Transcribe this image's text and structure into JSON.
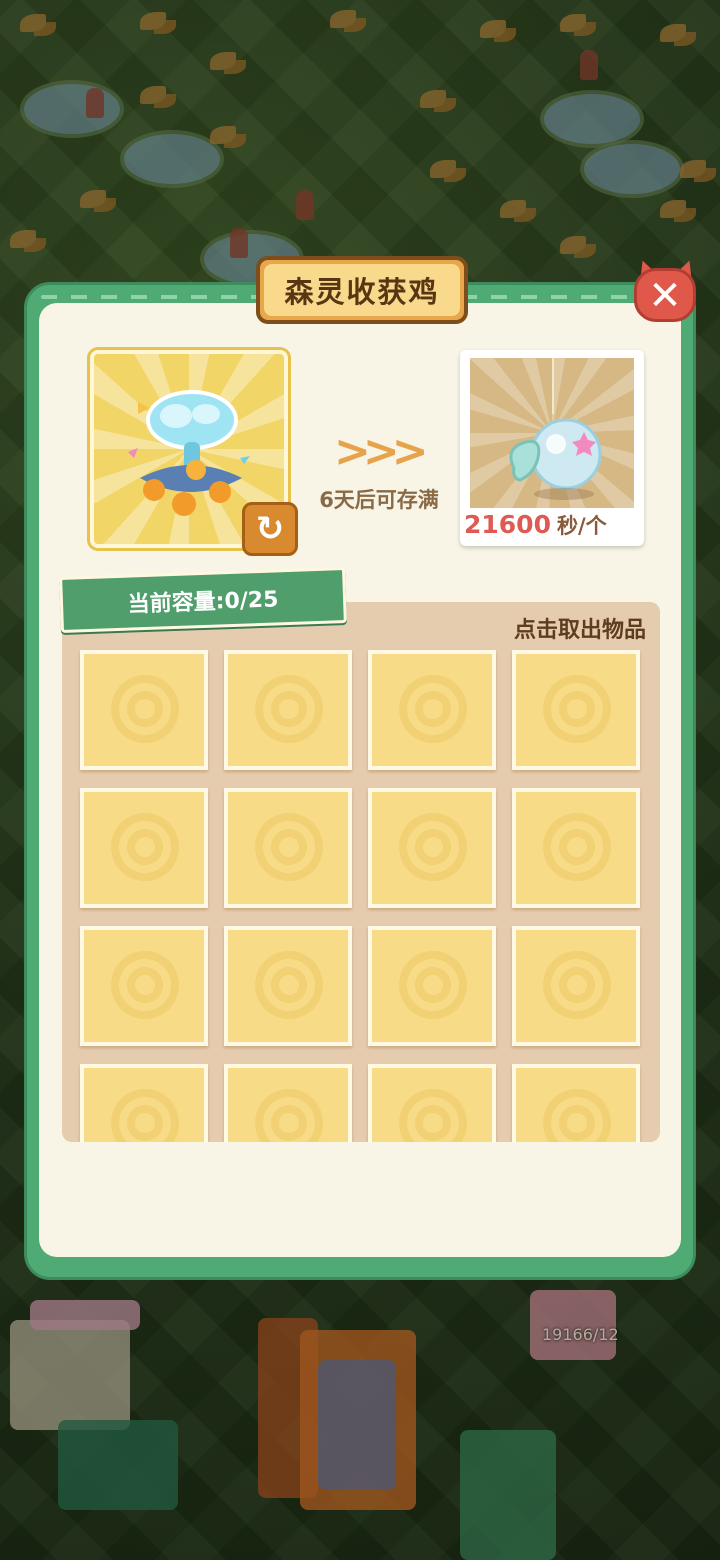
{
  "dialog": {
    "title": "森灵收获鸡",
    "close_icon": "close-icon"
  },
  "production": {
    "source_icon": "tree-of-chickens-icon",
    "swap_icon": "swap-arrow-icon",
    "arrows_text": ">>>",
    "fill_time_text": "6天后可存满",
    "output_icon": "spirit-bubble-icon",
    "rate_value": "21600",
    "rate_unit": "秒/个"
  },
  "storage": {
    "capacity_label": "当前容量:0/25",
    "tap_hint": "点击取出物品",
    "slot_count_visible": 16
  },
  "background": {
    "counter_text": "19166/12"
  },
  "colors": {
    "dialog_green": "#4faa74",
    "panel_cream": "#f8f5e6",
    "slot_yellow": "#f7db86",
    "rate_red": "#e05a54",
    "close_red": "#e0584a"
  }
}
